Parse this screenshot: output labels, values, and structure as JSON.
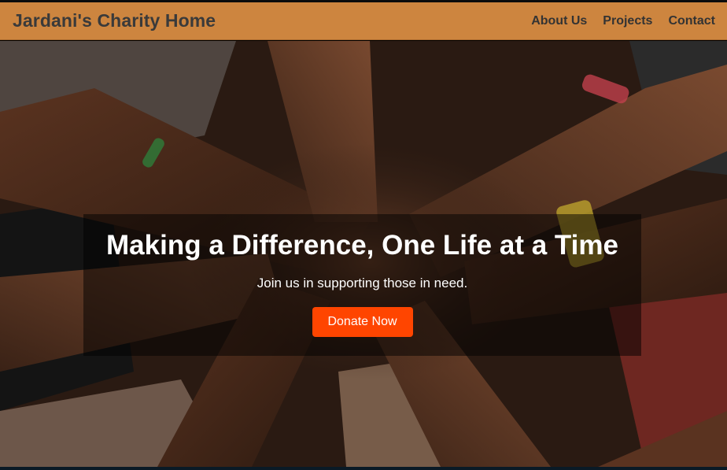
{
  "header": {
    "brand": "Jardani's Charity Home",
    "nav": [
      {
        "label": "About Us"
      },
      {
        "label": "Projects"
      },
      {
        "label": "Contact"
      }
    ]
  },
  "hero": {
    "title": "Making a Difference, One Life at a Time",
    "subtitle": "Join us in supporting those in need.",
    "cta_label": "Donate Now",
    "background_image": "stacked-hands-photo"
  },
  "colors": {
    "navbar": "#cd853f",
    "brand_text": "#3a3a3a",
    "cta": "#ff4500",
    "overlay": "rgba(0,0,0,0.5)"
  }
}
